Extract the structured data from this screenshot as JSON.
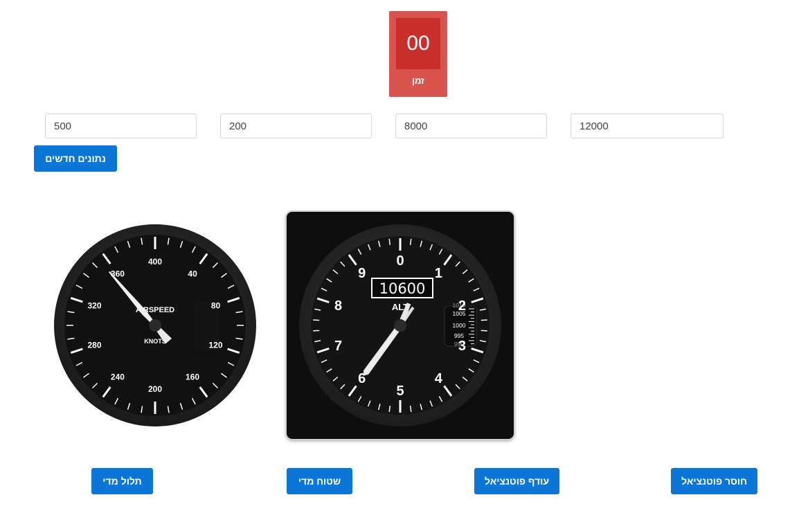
{
  "timer": {
    "value": "00",
    "label": "זמן"
  },
  "inputs": {
    "field1": "500",
    "field2": "200",
    "field3": "8000",
    "field4": "12000"
  },
  "buttons": {
    "new_data": "נתונים חדשים",
    "steep_measure": "תלול מדי",
    "flat_measure": "שטוח מדי",
    "surplus_potential": "עודף פוטנציאל",
    "deficit_potential": "חוסר פוטנציאל"
  },
  "airspeed": {
    "title": "AIRSPEED",
    "unit": "KNOTS",
    "scale_labels": [
      "40",
      "80",
      "120",
      "160",
      "200",
      "240",
      "280",
      "320",
      "360",
      "400"
    ],
    "needle_value": 355
  },
  "altimeter": {
    "readout": "10600",
    "label": "ALT",
    "digits": [
      "0",
      "1",
      "2",
      "3",
      "4",
      "5",
      "6",
      "7",
      "8",
      "9"
    ],
    "pressure_labels": [
      "1010",
      "1005",
      "1000",
      "995",
      "990"
    ],
    "altitude_ft": 10600
  },
  "colors": {
    "accent": "#0a76d8",
    "timer_bg": "#d9534f",
    "timer_inner": "#c9302c"
  }
}
